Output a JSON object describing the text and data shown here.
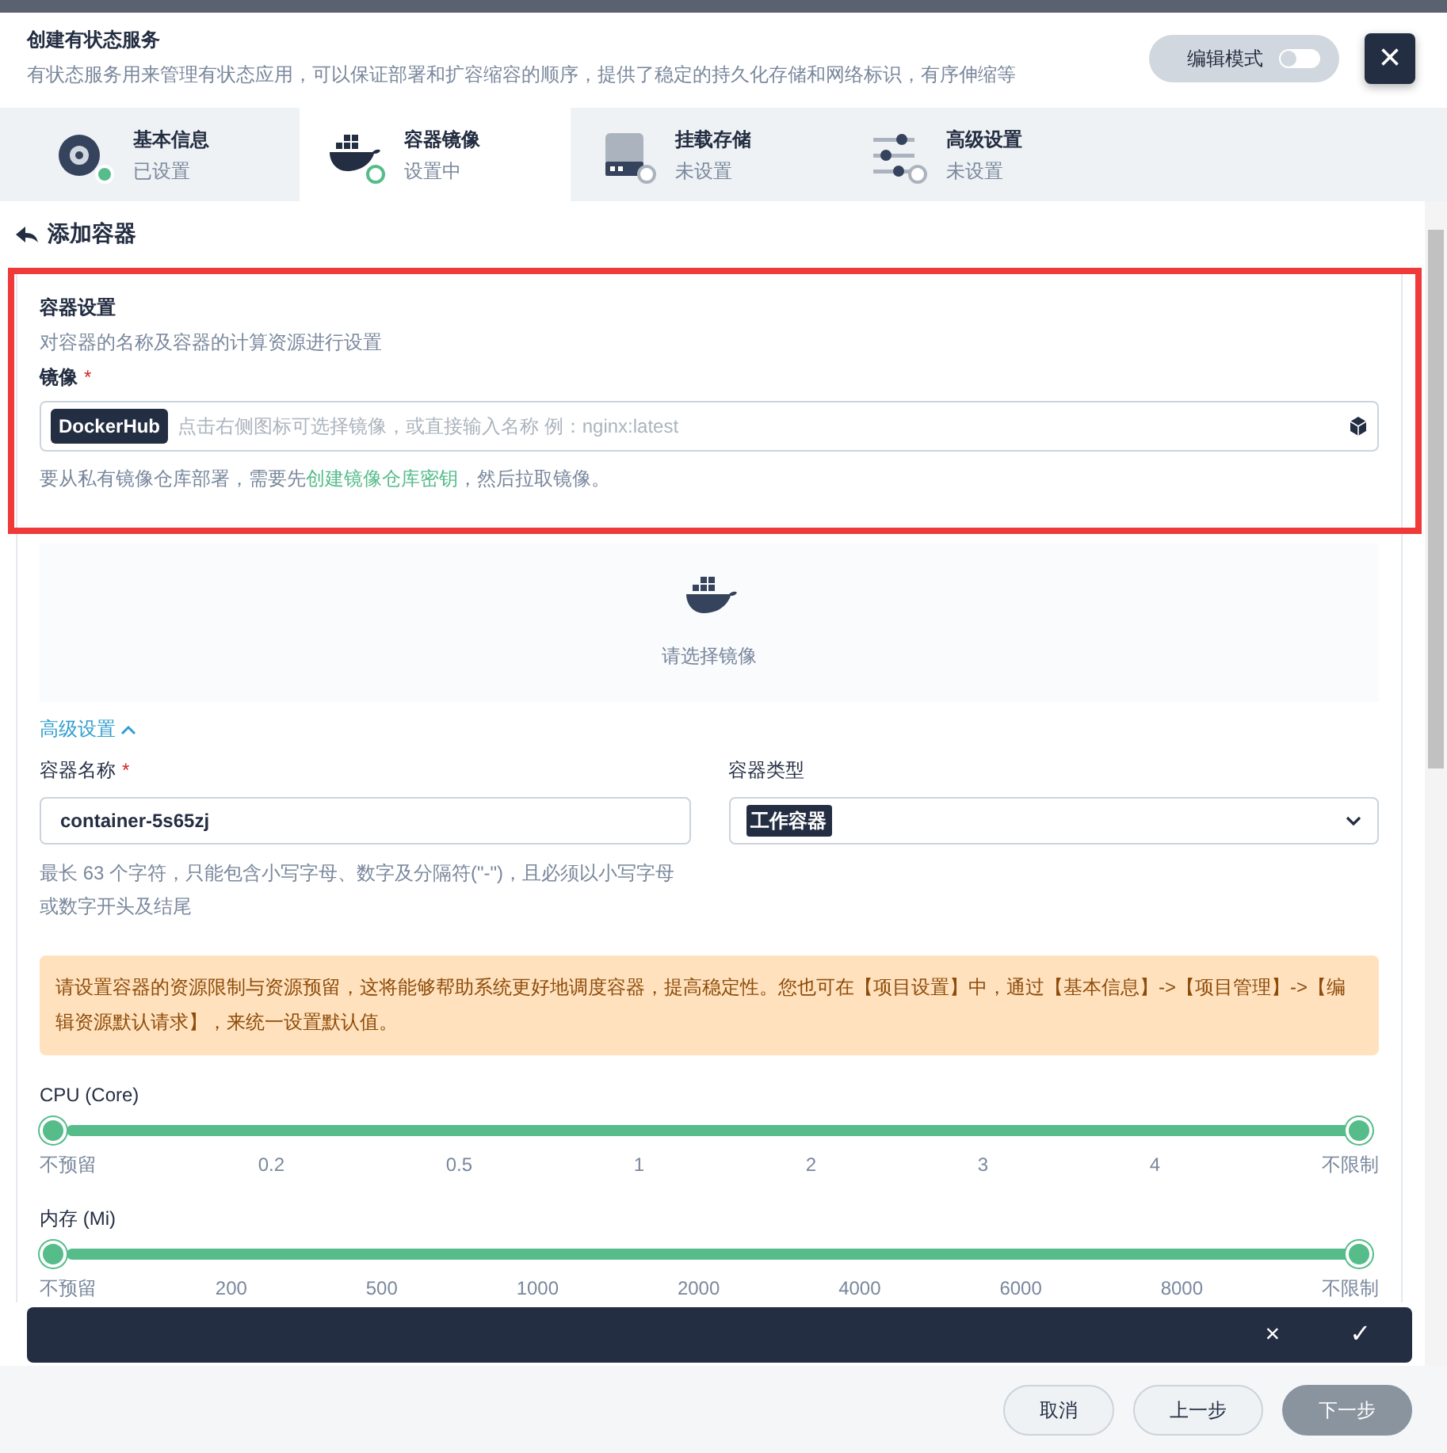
{
  "header": {
    "title": "创建有状态服务",
    "description": "有状态服务用来管理有状态应用，可以保证部署和扩容缩容的顺序，提供了稳定的持久化存储和网络标识，有序伸缩等",
    "edit_mode": {
      "label": "编辑模式",
      "on": false
    },
    "close": "×"
  },
  "steps": [
    {
      "title": "基本信息",
      "status_text": "已设置",
      "kind": "done",
      "selected": false
    },
    {
      "title": "容器镜像",
      "status_text": "设置中",
      "kind": "current",
      "selected": true
    },
    {
      "title": "挂载存储",
      "status_text": "未设置",
      "kind": "pending",
      "selected": false
    },
    {
      "title": "高级设置",
      "status_text": "未设置",
      "kind": "pending",
      "selected": false
    }
  ],
  "back_title": "添加容器",
  "container_settings": {
    "title": "容器设置",
    "description": "对容器的名称及容器的计算资源进行设置",
    "image_label": "镜像",
    "required_mark": "*",
    "registry": "DockerHub",
    "image_placeholder": "点击右侧图标可选择镜像，或直接输入名称 例：nginx:latest",
    "hint_before": "要从私有镜像仓库部署，需要先",
    "hint_link": "创建镜像仓库密钥",
    "hint_after": "，然后拉取镜像。"
  },
  "image_placeholder_panel": {
    "text": "请选择镜像"
  },
  "advanced_toggle": {
    "label": "高级设置",
    "expanded": true
  },
  "name_field": {
    "label": "容器名称",
    "required_mark": "*",
    "value": "container-5s65zj",
    "help": "最长 63 个字符，只能包含小写字母、数字及分隔符(\"-\")，且必须以小写字母或数字开头及结尾"
  },
  "type_field": {
    "label": "容器类型",
    "value": "工作容器"
  },
  "notice": "请设置容器的资源限制与资源预留，这将能够帮助系统更好地调度容器，提高稳定性。您也可在【项目设置】中，通过【基本信息】->【项目管理】->【编辑资源默认请求】，来统一设置默认值。",
  "sliders": [
    {
      "label": "CPU (Core)",
      "level": 1,
      "ticks": [
        "不预留",
        "0.2",
        "0.5",
        "1",
        "2",
        "3",
        "4",
        "不限制"
      ]
    },
    {
      "label": "内存 (Mi)",
      "level": 1,
      "ticks": [
        "不预留",
        "200",
        "500",
        "1000",
        "2000",
        "4000",
        "6000",
        "8000",
        "不限制"
      ]
    }
  ],
  "action_bar": {
    "cancel": "×",
    "confirm": "✓"
  },
  "footer": {
    "buttons": [
      {
        "label": "取消",
        "kind": "secondary"
      },
      {
        "label": "上一步",
        "kind": "secondary"
      },
      {
        "label": "下一步",
        "kind": "primary"
      }
    ]
  }
}
